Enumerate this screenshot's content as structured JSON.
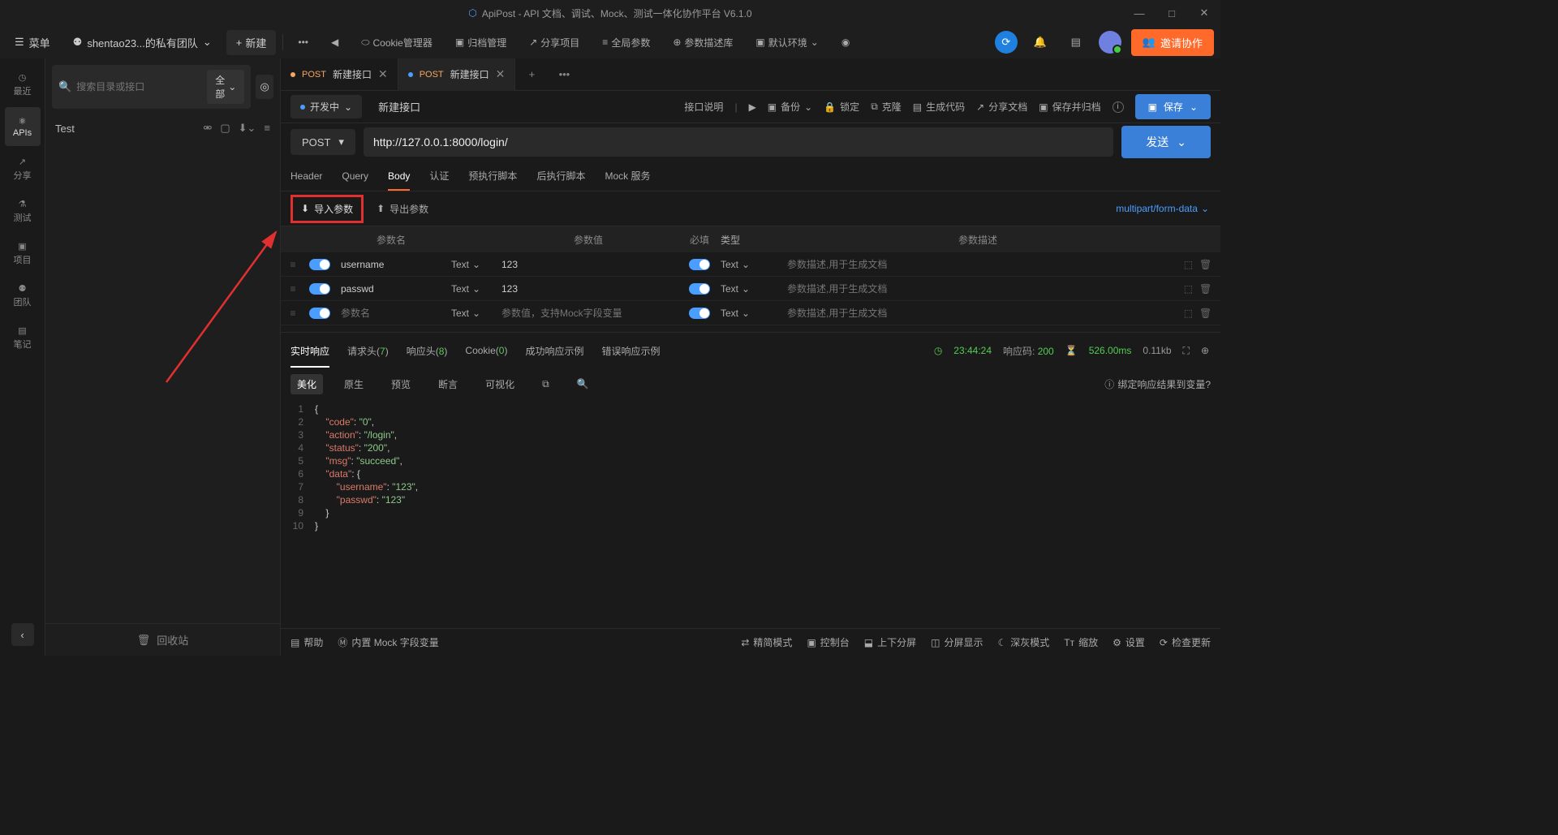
{
  "titlebar": {
    "app_icon": "⬡",
    "title": "ApiPost - API 文档、调试、Mock、测试一体化协作平台 V6.1.0"
  },
  "topbar": {
    "menu": "菜单",
    "team": "shentao23...的私有团队",
    "new_btn": "新建",
    "items": [
      "Cookie管理器",
      "归档管理",
      "分享项目",
      "全局参数",
      "参数描述库",
      "默认环境"
    ],
    "invite": "邀请协作"
  },
  "leftnav": [
    {
      "icon": "◷",
      "label": "最近"
    },
    {
      "icon": "⚛",
      "label": "APIs",
      "active": true
    },
    {
      "icon": "↗",
      "label": "分享"
    },
    {
      "icon": "⚗",
      "label": "测试"
    },
    {
      "icon": "▣",
      "label": "项目"
    },
    {
      "icon": "⚉",
      "label": "团队"
    },
    {
      "icon": "▤",
      "label": "笔记"
    }
  ],
  "sidebar": {
    "search_ph": "搜索目录或接口",
    "filter": "全部",
    "root": "Test",
    "recycle": "回收站"
  },
  "tabs": [
    {
      "dot": "#f7a760",
      "method": "POST",
      "name": "新建接口",
      "active": false
    },
    {
      "dot": "#4a9eff",
      "method": "POST",
      "name": "新建接口",
      "active": true
    }
  ],
  "action": {
    "status": "开发中",
    "name": "新建接口",
    "desc": "接口说明",
    "items": [
      "备份",
      "锁定",
      "克隆",
      "生成代码",
      "分享文档",
      "保存并归档"
    ],
    "save": "保存"
  },
  "request": {
    "method": "POST",
    "url": "http://127.0.0.1:8000/login/",
    "send": "发送"
  },
  "subtabs": [
    "Header",
    "Query",
    "Body",
    "认证",
    "预执行脚本",
    "后执行脚本",
    "Mock 服务"
  ],
  "active_subtab": "Body",
  "param_tools": {
    "import": "导入参数",
    "export": "导出参数",
    "ctype": "multipart/form-data"
  },
  "param_head": {
    "name": "参数名",
    "val": "参数值",
    "req": "必填",
    "type": "类型",
    "desc": "参数描述"
  },
  "params": [
    {
      "name": "username",
      "type": "Text",
      "val": "123",
      "dtype": "Text"
    },
    {
      "name": "passwd",
      "type": "Text",
      "val": "123",
      "dtype": "Text"
    }
  ],
  "param_ph": {
    "name": "参数名",
    "val": "参数值，支持Mock字段变量",
    "desc": "参数描述,用于生成文档",
    "type": "Text",
    "dtype": "Text"
  },
  "resp_tabs": [
    {
      "label": "实时响应",
      "active": true
    },
    {
      "label": "请求头",
      "count": "7"
    },
    {
      "label": "响应头",
      "count": "8"
    },
    {
      "label": "Cookie",
      "count": "0"
    },
    {
      "label": "成功响应示例"
    },
    {
      "label": "错误响应示例"
    }
  ],
  "resp_meta": {
    "time": "23:44:24",
    "code_lbl": "响应码:",
    "code": "200",
    "dur": "526.00ms",
    "size": "0.11kb"
  },
  "view_tabs": [
    "美化",
    "原生",
    "预览",
    "断言",
    "可视化"
  ],
  "bind_q": "绑定响应结果到变量?",
  "code_lines": [
    "{",
    "    \"code\": \"0\",",
    "    \"action\": \"/login\",",
    "    \"status\": \"200\",",
    "    \"msg\": \"succeed\",",
    "    \"data\": {",
    "        \"username\": \"123\",",
    "        \"passwd\": \"123\"",
    "    }",
    "}"
  ],
  "bottombar": {
    "left": [
      "帮助",
      "内置 Mock 字段变量"
    ],
    "right": [
      "精简模式",
      "控制台",
      "上下分屏",
      "分屏显示",
      "深灰模式",
      "缩放",
      "设置",
      "检查更新"
    ]
  }
}
